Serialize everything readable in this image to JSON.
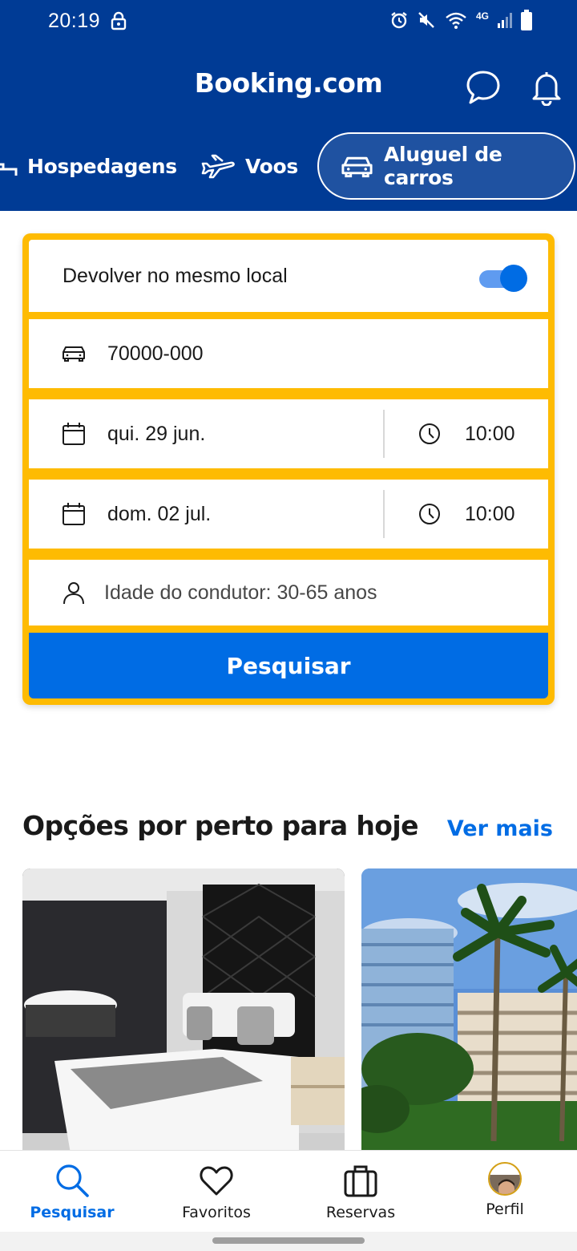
{
  "status_bar": {
    "time": "20:19",
    "network": "4G"
  },
  "header": {
    "brand": "Booking.com",
    "icons": [
      "chat-bubble-icon",
      "bell-icon"
    ]
  },
  "tabs": [
    {
      "label": "Hospedagens",
      "icon": "bed-icon",
      "active": false
    },
    {
      "label": "Voos",
      "icon": "plane-icon",
      "active": false
    },
    {
      "label": "Aluguel de carros",
      "icon": "car-icon",
      "active": true
    }
  ],
  "search_form": {
    "same_location_label": "Devolver no mesmo local",
    "same_location_on": true,
    "location_value": "70000-000",
    "pickup_date": "qui. 29 jun.",
    "pickup_time": "10:00",
    "return_date": "dom. 02 jul.",
    "return_time": "10:00",
    "driver_age": "Idade do condutor: 30-65 anos",
    "search_button": "Pesquisar"
  },
  "nearby": {
    "title": "Opções por perto para hoje",
    "see_more": "Ver mais"
  },
  "bottom_nav": [
    {
      "label": "Pesquisar",
      "icon": "search-icon",
      "active": true
    },
    {
      "label": "Favoritos",
      "icon": "heart-icon",
      "active": false
    },
    {
      "label": "Reservas",
      "icon": "suitcase-icon",
      "active": false
    },
    {
      "label": "Perfil",
      "icon": "avatar",
      "active": false
    }
  ],
  "colors": {
    "header_bg": "#003b95",
    "card_border": "#febb02",
    "primary": "#006ce4"
  }
}
